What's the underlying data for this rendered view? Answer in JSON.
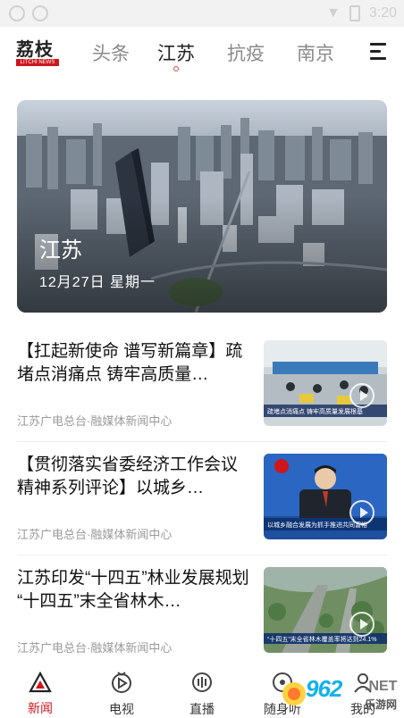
{
  "statusbar": {
    "time": "3:20"
  },
  "header": {
    "logo_zh": "荔枝",
    "logo_en": "LITCHI NEWS",
    "tabs": [
      {
        "label": "头条"
      },
      {
        "label": "江苏"
      },
      {
        "label": "抗疫"
      },
      {
        "label": "南京"
      }
    ],
    "active_tab": "江苏"
  },
  "hero": {
    "title": "江苏",
    "date": "12月27日 星期一"
  },
  "news": [
    {
      "title": "【扛起新使命 谱写新篇章】疏堵点消痛点 铸牢高质量…",
      "source": "江苏广电总台·融媒体新闻中心",
      "thumb_caption": "疏堵点消痛点 铸牢高质量发展根基"
    },
    {
      "title": "【贯彻落实省委经济工作会议精神系列评论】以城乡…",
      "source": "江苏广电总台·融媒体新闻中心",
      "thumb_caption": "以城乡融合发展为抓手推进共同富裕"
    },
    {
      "title": "江苏印发“十四五”林业发展规划 “十四五”末全省林木…",
      "source": "江苏广电总台·融媒体新闻中心",
      "thumb_caption": "“十四五”末全省林木覆盖率将达到24.1%"
    }
  ],
  "bottom_nav": [
    {
      "label": "新闻",
      "icon": "news-tab-icon"
    },
    {
      "label": "电视",
      "icon": "tv-tab-icon"
    },
    {
      "label": "直播",
      "icon": "live-tab-icon"
    },
    {
      "label": "随身听",
      "icon": "audio-tab-icon"
    },
    {
      "label": "我的",
      "icon": "profile-tab-icon"
    }
  ],
  "watermark": {
    "number": "962",
    "net": ".NET",
    "cn": "乐游网"
  },
  "colors": {
    "brand_red": "#d0161b",
    "watermark_blue": "#0fb2e8"
  }
}
